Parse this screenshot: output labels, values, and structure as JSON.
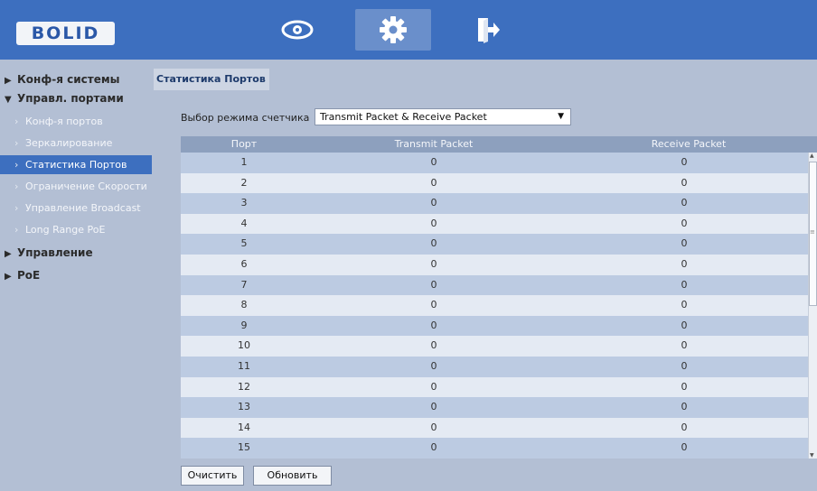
{
  "brand": {
    "logo": "BOLID"
  },
  "topnav": [
    {
      "name": "view",
      "icon": "eye-icon"
    },
    {
      "name": "settings",
      "icon": "gear-icon",
      "active": true
    },
    {
      "name": "logout",
      "icon": "exit-icon"
    }
  ],
  "sidebar": {
    "sections": [
      {
        "label": "Конф-я системы",
        "expanded": false
      },
      {
        "label": "Управл. портами",
        "expanded": true
      },
      {
        "label": "Управление",
        "expanded": false
      },
      {
        "label": "PoE",
        "expanded": false
      }
    ],
    "items": [
      {
        "label": "Конф-я портов"
      },
      {
        "label": "Зеркалирование"
      },
      {
        "label": "Статистика Портов",
        "active": true
      },
      {
        "label": "Ограничение Скорости"
      },
      {
        "label": "Управление Broadcast"
      },
      {
        "label": "Long Range PoE"
      }
    ]
  },
  "main": {
    "tab": "Статистика Портов",
    "mode_label": "Выбор режима счетчика",
    "mode_value": "Transmit Packet & Receive Packet",
    "columns": [
      "Порт",
      "Transmit Packet",
      "Receive Packet"
    ],
    "rows": [
      [
        "1",
        "0",
        "0"
      ],
      [
        "2",
        "0",
        "0"
      ],
      [
        "3",
        "0",
        "0"
      ],
      [
        "4",
        "0",
        "0"
      ],
      [
        "5",
        "0",
        "0"
      ],
      [
        "6",
        "0",
        "0"
      ],
      [
        "7",
        "0",
        "0"
      ],
      [
        "8",
        "0",
        "0"
      ],
      [
        "9",
        "0",
        "0"
      ],
      [
        "10",
        "0",
        "0"
      ],
      [
        "11",
        "0",
        "0"
      ],
      [
        "12",
        "0",
        "0"
      ],
      [
        "13",
        "0",
        "0"
      ],
      [
        "14",
        "0",
        "0"
      ],
      [
        "15",
        "0",
        "0"
      ]
    ],
    "buttons": {
      "clear": "Очистить",
      "refresh": "Обновить"
    }
  },
  "colors": {
    "header": "#3d6fbf",
    "background": "#b3bfd4",
    "active": "#3d6fbf"
  }
}
